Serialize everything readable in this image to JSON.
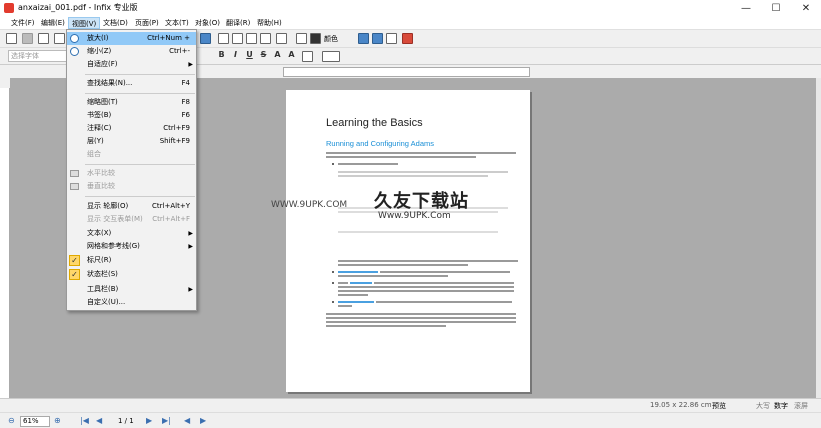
{
  "window": {
    "title": "anxaizai_001.pdf - Infix 专业版",
    "minimize": "—",
    "maximize": "☐",
    "close": "✕"
  },
  "menubar": {
    "items": [
      {
        "label": "文件(F)"
      },
      {
        "label": "编辑(E)"
      },
      {
        "label": "视图(V)"
      },
      {
        "label": "文档(D)"
      },
      {
        "label": "页面(P)"
      },
      {
        "label": "文本(T)"
      },
      {
        "label": "对象(O)"
      },
      {
        "label": "翻译(R)"
      },
      {
        "label": "帮助(H)"
      }
    ]
  },
  "toolbar": {
    "color_label": "颜色",
    "font_placeholder": "选择字体",
    "bold": "B",
    "italic": "I",
    "underline": "U",
    "strike": "S",
    "superscript": "A",
    "subscript": "A"
  },
  "view_menu": {
    "items": [
      {
        "label": "放大(I)",
        "shortcut": "Ctrl+Num +"
      },
      {
        "label": "缩小(Z)",
        "shortcut": "Ctrl+-"
      },
      {
        "label": "自适应(F)",
        "arrow": "▶"
      },
      {
        "label": "查找结果(N)...",
        "shortcut": "F4"
      },
      {
        "label": "缩略图(T)",
        "shortcut": "F8"
      },
      {
        "label": "书签(B)",
        "shortcut": "F6"
      },
      {
        "label": "注释(C)",
        "shortcut": "Ctrl+F9"
      },
      {
        "label": "层(Y)",
        "shortcut": "Shift+F9"
      },
      {
        "label": "组合"
      },
      {
        "label": "水平比较"
      },
      {
        "label": "垂直比较"
      },
      {
        "label": "显示 轮廓(O)",
        "shortcut": "Ctrl+Alt+Y"
      },
      {
        "label": "显示 交互表单(M)",
        "shortcut": "Ctrl+Alt+F"
      },
      {
        "label": "文本(X)",
        "arrow": "▶"
      },
      {
        "label": "网格和参考线(G)",
        "arrow": "▶"
      },
      {
        "label": "标尺(R)"
      },
      {
        "label": "状态栏(S)"
      },
      {
        "label": "工具栏(B)",
        "arrow": "▶"
      },
      {
        "label": "自定义(U)..."
      }
    ]
  },
  "document": {
    "heading": "Learning the Basics",
    "subheading": "Running and Configuring Adams"
  },
  "watermark": {
    "main": "久友下载站",
    "url": "Www.9UPK.Com",
    "side": "WWW.9UPK.COM"
  },
  "statusbar": {
    "page_size": "19.05 x 22.86 cm",
    "mode": "预览",
    "caps": "大写",
    "num": "数字",
    "scroll": "滚屏"
  },
  "navbar": {
    "zoom": "61%",
    "page": "1 / 1"
  }
}
